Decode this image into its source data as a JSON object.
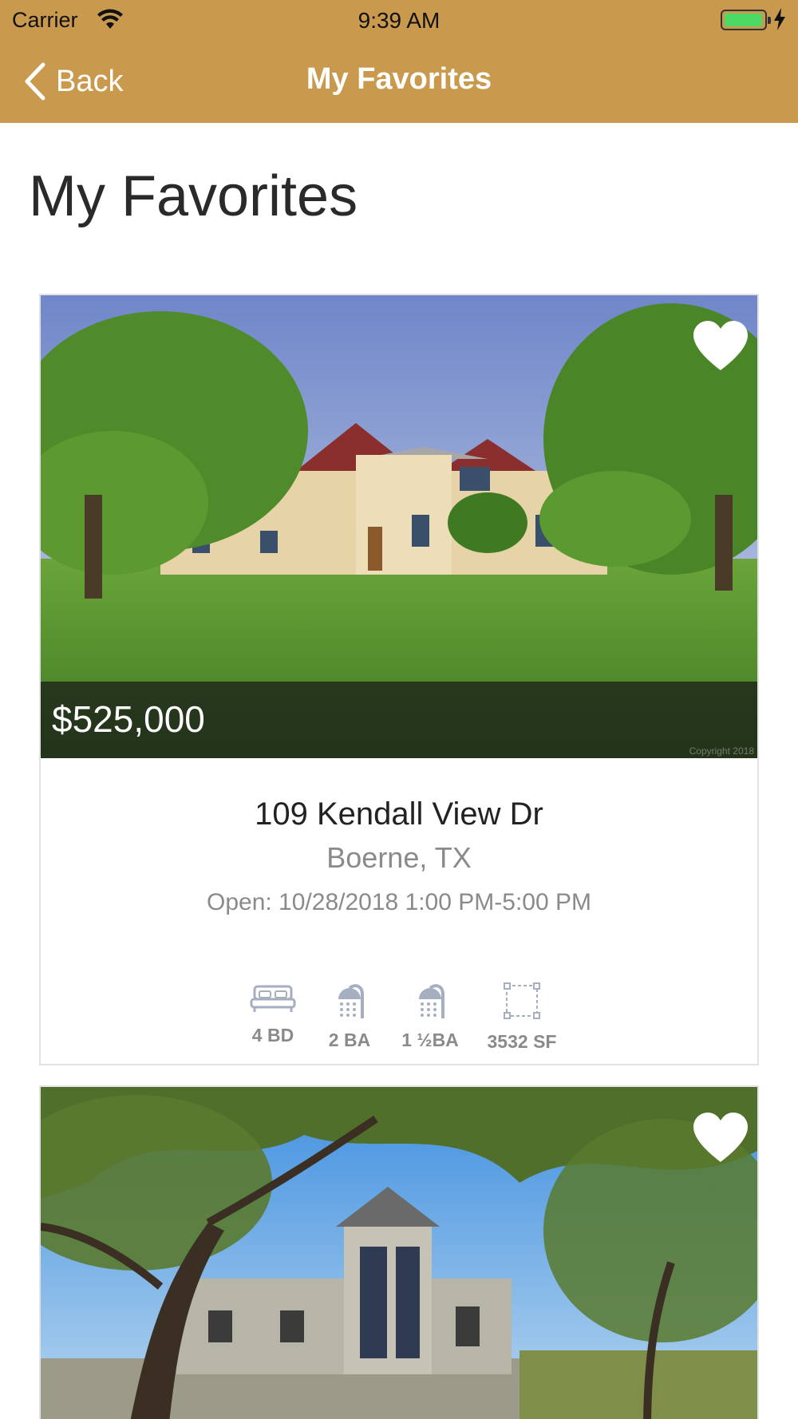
{
  "status_bar": {
    "carrier": "Carrier",
    "time": "9:39 AM",
    "battery_level": 1.0
  },
  "nav": {
    "back_label": "Back",
    "title": "My Favorites",
    "background_color": "#c99a4e"
  },
  "page": {
    "heading": "My Favorites"
  },
  "listings": [
    {
      "price": "$525,000",
      "photo_watermark": "Copyright 2018",
      "favorited": true,
      "address": "109 Kendall View Dr",
      "city": "Boerne, TX",
      "open_house": "Open: 10/28/2018 1:00 PM-5:00 PM",
      "stats": {
        "beds": "4 BD",
        "baths": "2 BA",
        "half_baths": "1 ½BA",
        "sqft": "3532 SF"
      }
    },
    {
      "favorited": true
    }
  ],
  "icons": [
    "back-chevron-icon",
    "wifi-icon",
    "battery-icon",
    "charging-bolt-icon",
    "heart-icon",
    "bed-icon",
    "shower-icon",
    "square-footage-icon"
  ]
}
